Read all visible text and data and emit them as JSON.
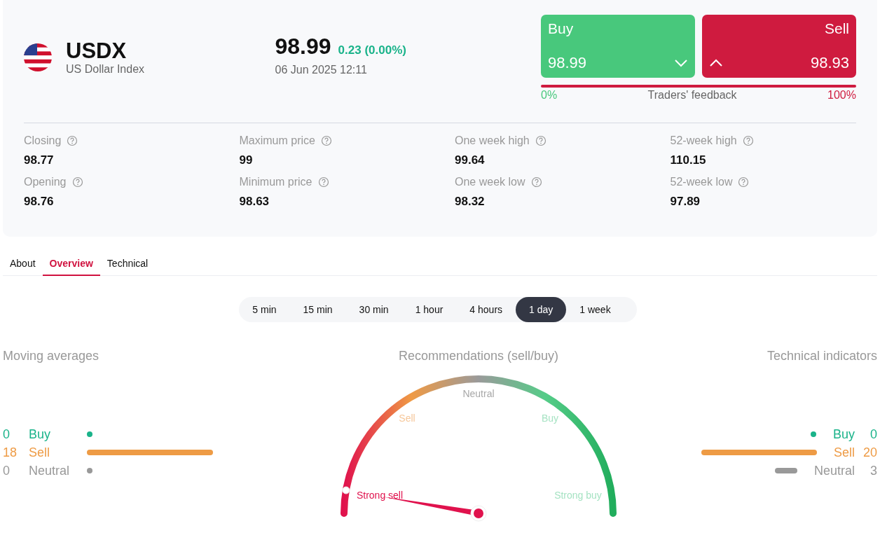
{
  "instrument": {
    "symbol": "USDX",
    "name": "US Dollar Index"
  },
  "quote": {
    "price": "98.99",
    "change": "0.23 (0.00%)",
    "datetime": "06 Jun 2025 12:11"
  },
  "trade": [
    {
      "kind": "buy",
      "label": "Buy",
      "price": "98.99"
    },
    {
      "kind": "sell",
      "label": "Sell",
      "price": "98.93"
    }
  ],
  "feedback": {
    "level": 0,
    "min": "0%",
    "label": "Traders' feedback",
    "max": "100%"
  },
  "stats": [
    {
      "label": "Closing",
      "value": "98.77"
    },
    {
      "label": "Maximum price",
      "value": "99"
    },
    {
      "label": "One week high",
      "value": "99.64"
    },
    {
      "label": "52-week high",
      "value": "110.15"
    },
    {
      "label": "Opening",
      "value": "98.76"
    },
    {
      "label": "Minimum price",
      "value": "98.63"
    },
    {
      "label": "One week low",
      "value": "98.32"
    },
    {
      "label": "52-week low",
      "value": "97.89"
    }
  ],
  "tabs": [
    {
      "label": "About",
      "selected": false
    },
    {
      "label": "Overview",
      "selected": true
    },
    {
      "label": "Technical",
      "selected": false
    }
  ],
  "periods": [
    {
      "label": "5 min",
      "selected": false
    },
    {
      "label": "15 min",
      "selected": false
    },
    {
      "label": "30 min",
      "selected": false
    },
    {
      "label": "1 hour",
      "selected": false
    },
    {
      "label": "4 hours",
      "selected": false
    },
    {
      "label": "1 day",
      "selected": true
    },
    {
      "label": "1 week",
      "selected": false
    }
  ],
  "moving_averages": {
    "title": "Moving averages",
    "rows": [
      {
        "kind": "buy",
        "count": "0",
        "label": "Buy"
      },
      {
        "kind": "sell",
        "count": "18",
        "label": "Sell"
      },
      {
        "kind": "neutral",
        "count": "0",
        "label": "Neutral"
      }
    ]
  },
  "recommendations": {
    "title": "Recommendations (sell/buy)",
    "level": 0.055,
    "labels": [
      {
        "kind": "neutral",
        "label": "Neutral",
        "selected": false
      },
      {
        "kind": "sell",
        "label": "Sell",
        "selected": false
      },
      {
        "kind": "buy",
        "label": "Buy",
        "selected": false
      },
      {
        "kind": "strong-sell",
        "label": "Strong sell",
        "selected": true
      },
      {
        "kind": "strong-buy",
        "label": "Strong buy",
        "selected": false
      }
    ]
  },
  "technical_indicators": {
    "title": "Technical indicators",
    "rows": [
      {
        "kind": "buy",
        "count": "0",
        "label": "Buy"
      },
      {
        "kind": "sell",
        "count": "20",
        "label": "Sell"
      },
      {
        "kind": "neutral",
        "count": "3",
        "label": "Neutral"
      }
    ]
  }
}
